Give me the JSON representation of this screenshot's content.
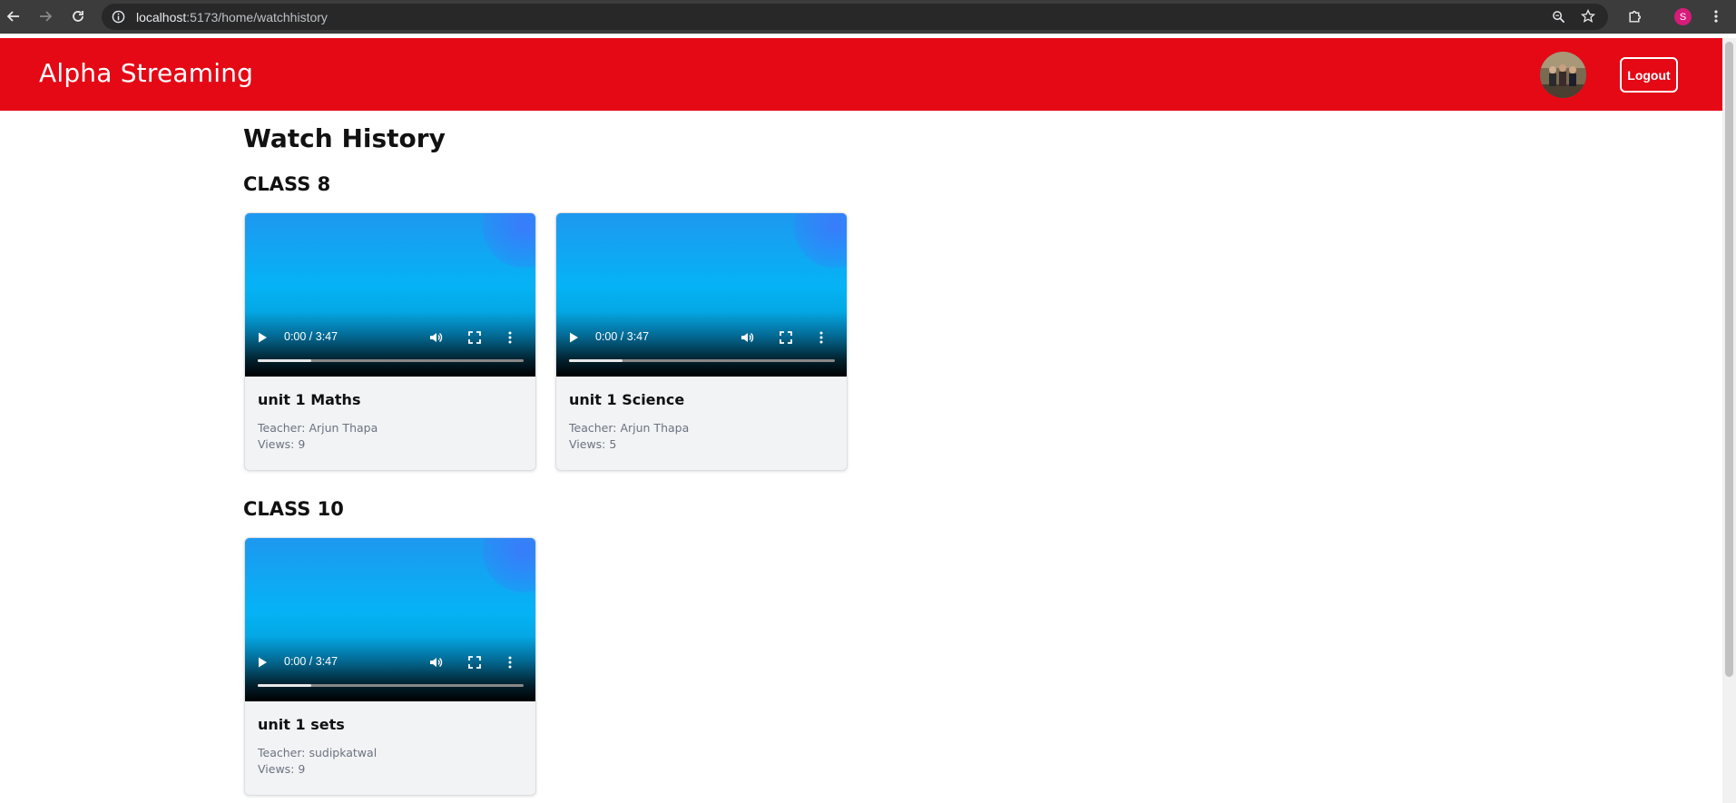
{
  "browser": {
    "url_host": "localhost",
    "url_rest": ":5173/home/watchhistory",
    "profile_initial": "S"
  },
  "header": {
    "title": "Alpha Streaming",
    "logout_label": "Logout",
    "brand_color": "#e50815"
  },
  "page": {
    "title": "Watch History"
  },
  "sections": [
    {
      "name": "CLASS 8",
      "videos": [
        {
          "title": "unit 1 Maths",
          "teacher": "Teacher: Arjun Thapa",
          "views": "Views: 9",
          "time": "0:00 / 3:47",
          "buffered_fraction": 0.2
        },
        {
          "title": "unit 1 Science",
          "teacher": "Teacher: Arjun Thapa",
          "views": "Views: 5",
          "time": "0:00 / 3:47",
          "buffered_fraction": 0.2
        }
      ]
    },
    {
      "name": "CLASS 10",
      "videos": [
        {
          "title": "unit 1 sets",
          "teacher": "Teacher: sudipkatwal",
          "views": "Views: 9",
          "time": "0:00 / 3:47",
          "buffered_fraction": 0.2
        }
      ]
    }
  ]
}
